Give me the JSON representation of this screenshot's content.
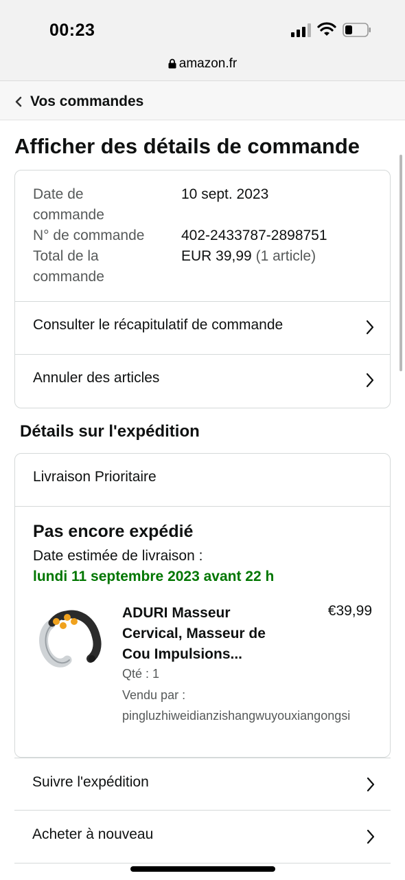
{
  "status": {
    "time": "00:23"
  },
  "browser": {
    "url": "amazon.fr"
  },
  "nav": {
    "back_label": "Vos commandes"
  },
  "page": {
    "title": "Afficher des détails de commande"
  },
  "order": {
    "date_label_1": "Date de",
    "date_label_2": "commande",
    "date_value": "10 sept. 2023",
    "number_label": "N° de commande",
    "number_value": "402-2433787-2898751",
    "total_label_1": "Total de la",
    "total_label_2": "commande",
    "total_value": "EUR 39,99",
    "total_count": "(1 article)",
    "summary_link": "Consulter le récapitulatif de commande",
    "cancel_link": "Annuler des articles"
  },
  "shipping": {
    "section_title": "Détails sur l'expédition",
    "method": "Livraison Prioritaire",
    "status": "Pas encore expédié",
    "estimate_label": "Date estimée de livraison :",
    "estimate_date": "lundi 11 septembre 2023 avant 22 h",
    "product": {
      "title_line1": "ADURI Masseur",
      "title_line2": "Cervical, Masseur de",
      "title_line3": "Cou Impulsions...",
      "price": "€39,99",
      "qty": "Qté : 1",
      "seller_label": "Vendu par :",
      "seller": "pingluzhiweidianzishangwuyouxiangongsi"
    },
    "track_link": "Suivre l'expédition",
    "rebuy_link": "Acheter à nouveau"
  },
  "colors": {
    "green_date": "#007600",
    "border": "#d5d9d9",
    "muted_text": "#565959"
  }
}
